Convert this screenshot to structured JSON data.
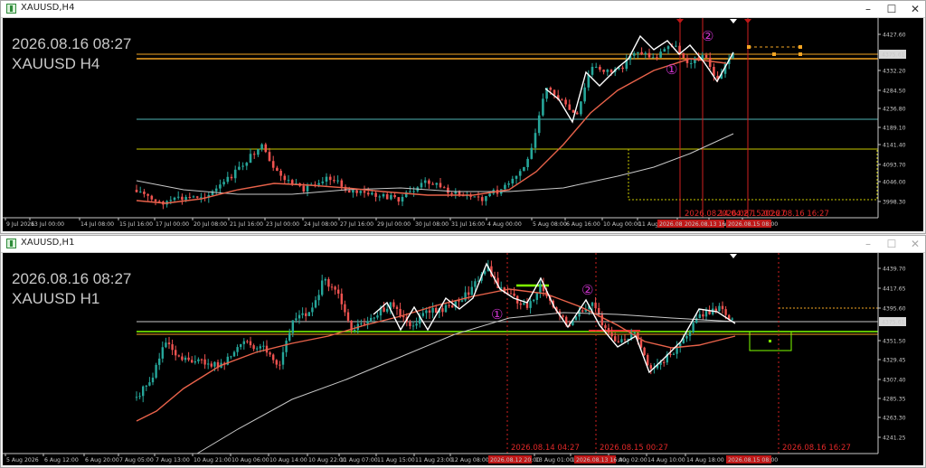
{
  "top": {
    "title": "XAUUSD,H4",
    "symbol_desc": "XAUUSD, H4:  Gold US Dollar",
    "overlay_date": "2026.08.16 08:27",
    "overlay_symbol": "XAUUSD H4",
    "price_labels": [
      "4427.60",
      "4375.61",
      "4332.20",
      "4284.50",
      "4236.80",
      "4189.10",
      "4141.40",
      "4093.70",
      "4046.00",
      "3998.30"
    ],
    "current_price": "4375.61",
    "time_labels": [
      "9 Jul 2026",
      "13 Jul 00:00",
      "14 Jul 08:00",
      "15 Jul 16:00",
      "17 Jul 00:00",
      "20 Jul 08:00",
      "21 Jul 16:00",
      "23 Jul 00:00",
      "24 Jul 08:00",
      "27 Jul 16:00",
      "29 Jul 00:00",
      "30 Jul 08:00",
      "31 Jul 16:00",
      "4 Aug 00:00",
      "5 Aug 08:00",
      "6 Aug 16:00",
      "10 Aug 00:00",
      "11 Aug",
      "13 Aug",
      "14 Aug",
      "15 Aug"
    ],
    "time_marker_labels": [
      "2026.08.1",
      "2026.08.13 16:00",
      "2026.08.15 08:00"
    ],
    "vline_labels": [
      "2026.08.14 04:27",
      "2026.08.15 00:27",
      "2026.08.16 16:27"
    ],
    "circles": [
      "①",
      "②"
    ]
  },
  "bottom": {
    "title": "XAUUSD,H1",
    "symbol_desc": "XAUUSD, H1:  Gold US Dollar",
    "overlay_date": "2026.08.16 08:27",
    "overlay_symbol": "XAUUSD H1",
    "price_labels": [
      "4439.70",
      "4417.65",
      "4395.60",
      "4375.61",
      "4351.50",
      "4329.45",
      "4307.40",
      "4285.35",
      "4263.30",
      "4241.25"
    ],
    "current_price": "4375.61",
    "time_labels": [
      "5 Aug 2026",
      "6 Aug 12:00",
      "6 Aug 20:00",
      "7 Aug 05:00",
      "7 Aug 13:00",
      "10 Aug 21:00",
      "10 Aug 06:00",
      "10 Aug 14:00",
      "10 Aug 22:00",
      "11 Aug 07:00",
      "11 Aug 15:00",
      "11 Aug 23:00",
      "12 Aug 08:00",
      "13 Aug 01:00",
      "13 Aug 17:00",
      "14 Aug 02:00",
      "14 Aug 10:00",
      "14 Aug 18:00"
    ],
    "time_marker_labels": [
      "2026.08.12 20:00",
      "2026.08.13 16:00",
      "2026.08.15 08:00"
    ],
    "vline_labels": [
      "2026.08.14 04:27",
      "2026.08.15 00:27",
      "2026.08.16 16:27"
    ],
    "circles": [
      "①",
      "②"
    ]
  },
  "colors": {
    "bull": "#26a69a",
    "bear": "#ef5350",
    "ma_fast": "#e8624a",
    "ma_slow": "#c8c8c8",
    "zigzag": "#ffffff",
    "vline": "#d02020",
    "level_orange": "#f5a623",
    "level_yellow": "#c8c800",
    "level_green": "#7fff00",
    "level_teal": "#4fb3b3",
    "circle": "#cc33cc"
  },
  "icons": {
    "window": "chart-window-icon",
    "minimize": "minimize-icon",
    "maximize": "maximize-icon",
    "close": "close-icon"
  }
}
